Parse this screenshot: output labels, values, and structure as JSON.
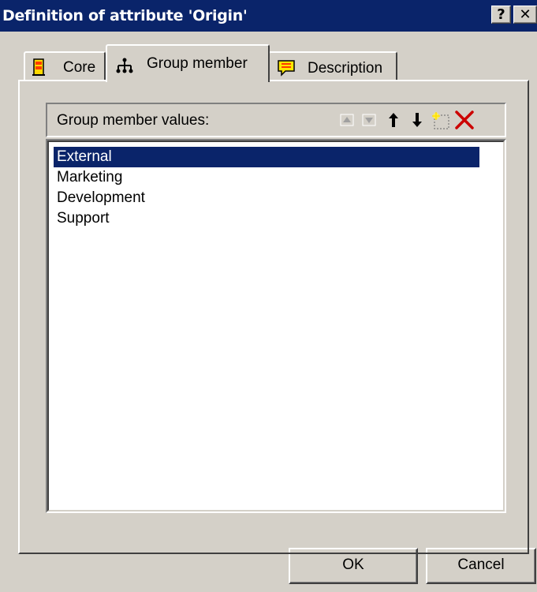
{
  "window": {
    "title": "Definition of attribute 'Origin'",
    "help_label": "?",
    "close_label": "✕"
  },
  "tabs": [
    {
      "label": "Core",
      "icon": "core-icon",
      "active": false
    },
    {
      "label": "Group member",
      "icon": "group-member-icon",
      "active": true
    },
    {
      "label": "Description",
      "icon": "description-icon",
      "active": false
    }
  ],
  "group_member": {
    "header_label": "Group member values:",
    "toolbar": [
      {
        "name": "move-up-disabled-icon",
        "enabled": false
      },
      {
        "name": "move-down-disabled-icon",
        "enabled": false
      },
      {
        "name": "move-up-icon",
        "enabled": true
      },
      {
        "name": "move-down-icon",
        "enabled": true
      },
      {
        "name": "new-item-icon",
        "enabled": true
      },
      {
        "name": "delete-icon",
        "enabled": true
      }
    ],
    "values": [
      "External",
      "Marketing",
      "Development",
      "Support"
    ],
    "selected_index": 0
  },
  "buttons": {
    "ok_label": "OK",
    "cancel_label": "Cancel"
  },
  "colors": {
    "titlebar": "#0a246a",
    "selection": "#0a246a",
    "face": "#d4d0c8",
    "delete_red": "#cc0000"
  }
}
